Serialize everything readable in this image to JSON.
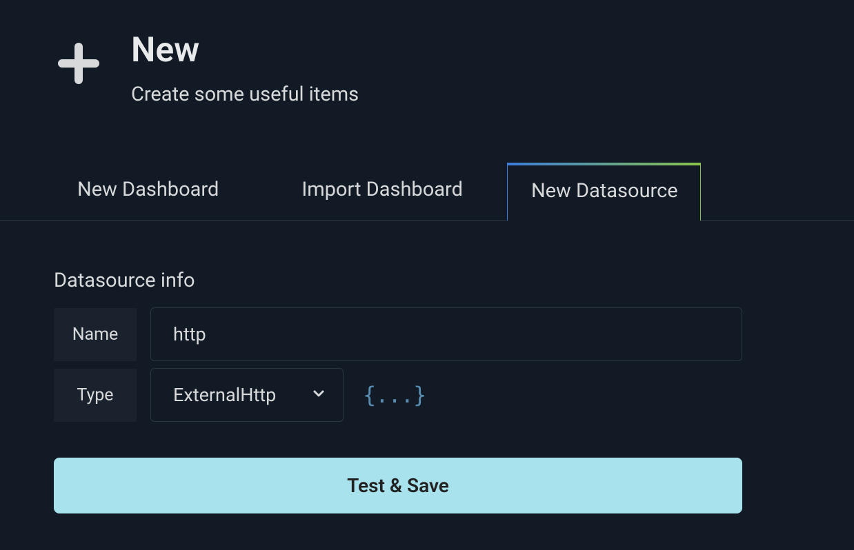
{
  "header": {
    "title": "New",
    "subtitle": "Create some useful items"
  },
  "tabs": {
    "new_dashboard": "New Dashboard",
    "import_dashboard": "Import Dashboard",
    "new_datasource": "New Datasource"
  },
  "section": {
    "title": "Datasource info"
  },
  "form": {
    "name_label": "Name",
    "name_value": "http",
    "type_label": "Type",
    "type_value": "ExternalHttp",
    "json_icon_label": "{...}"
  },
  "buttons": {
    "test_save": "Test & Save"
  }
}
